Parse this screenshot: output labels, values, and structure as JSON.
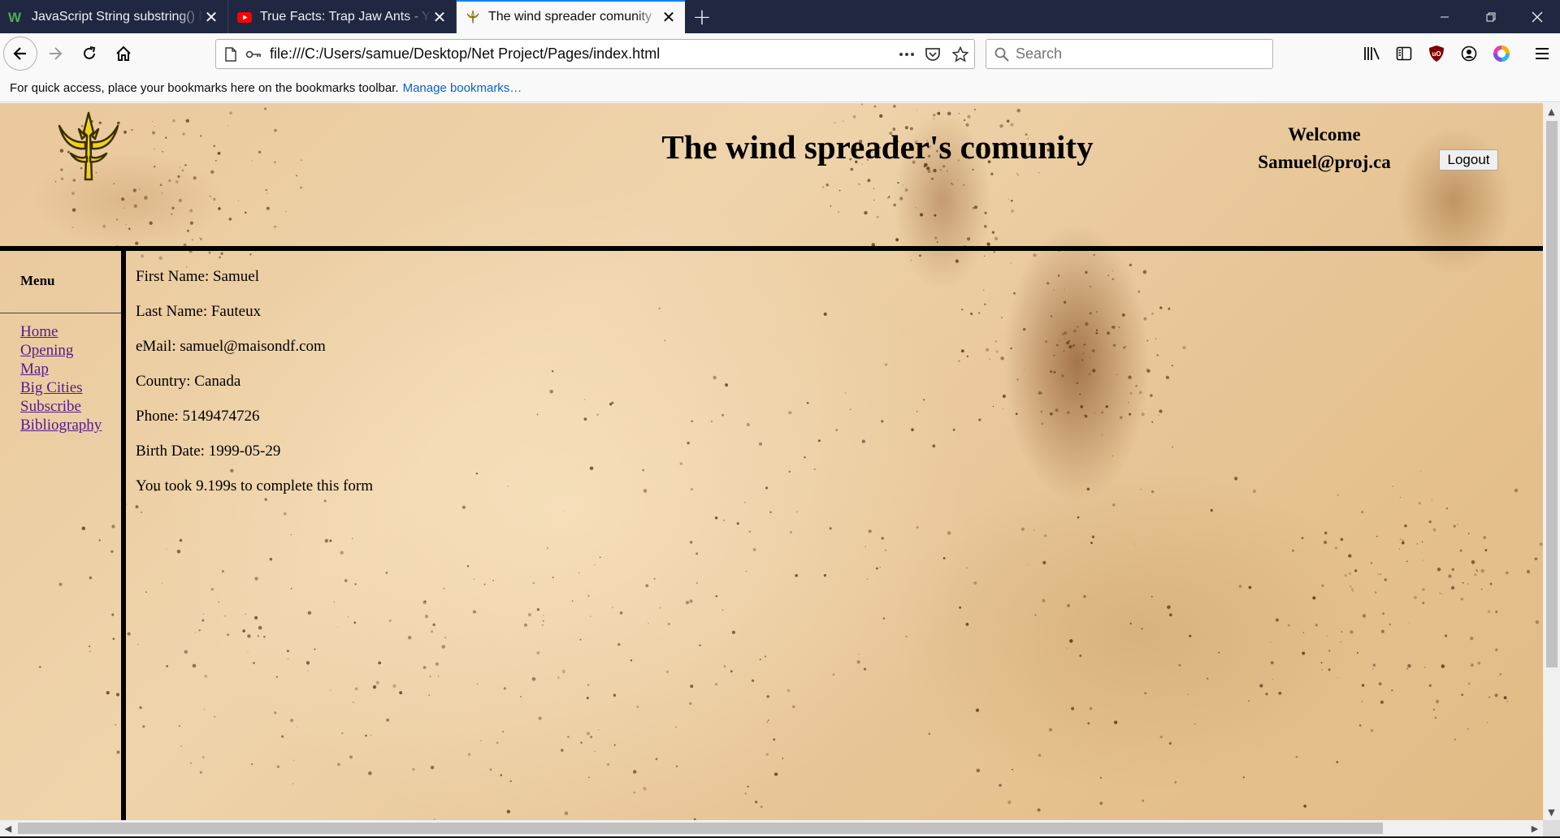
{
  "browser": {
    "tabs": [
      {
        "title": "JavaScript String substring() Me",
        "favicon": "w3schools-icon",
        "active": false
      },
      {
        "title": "True Facts: Trap Jaw Ants - YouT",
        "favicon": "youtube-icon",
        "active": false
      },
      {
        "title": "The wind spreader comunity",
        "favicon": "site-logo-icon",
        "active": true
      }
    ],
    "url": "file:///C:/Users/samue/Desktop/Net Project/Pages/index.html",
    "search_placeholder": "Search",
    "bookmarks_hint": "For quick access, place your bookmarks here on the bookmarks toolbar.",
    "manage_bookmarks": "Manage bookmarks…",
    "accent": "#0a84ff"
  },
  "page": {
    "title": "The wind spreader's comunity",
    "welcome_line": "Welcome",
    "user_email": "Samuel@proj.ca",
    "logout_label": "Logout",
    "menu": {
      "title": "Menu",
      "items": [
        "Home",
        "Opening",
        "Map",
        "Big Cities",
        "Subscribe",
        "Bibliography"
      ]
    },
    "profile": [
      "First Name: Samuel",
      "Last Name: Fauteux",
      "eMail: samuel@maisondf.com",
      "Country: Canada",
      "Phone: 5149474726",
      "Birth Date: 1999-05-29",
      "You took 9.199s to complete this form"
    ],
    "link_color": "#551a8b"
  }
}
